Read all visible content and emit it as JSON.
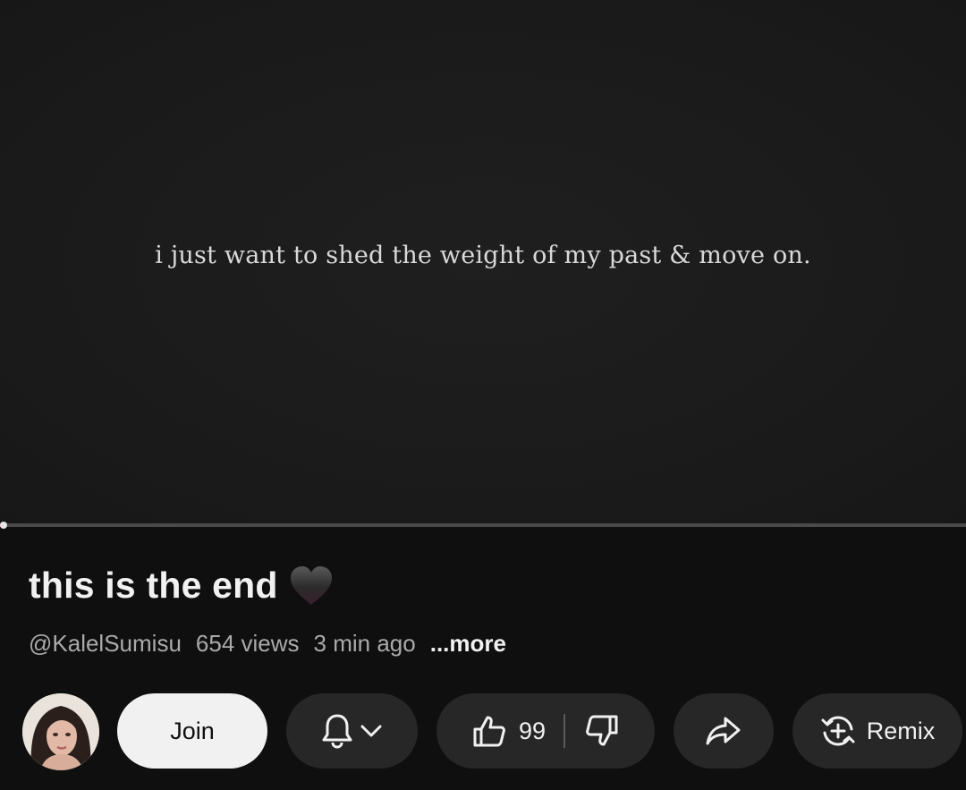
{
  "video": {
    "caption": "i just want to shed the weight of my past & move on."
  },
  "info": {
    "title": "this is the end",
    "channel": "@KalelSumisu",
    "views": "654 views",
    "time_ago": "3 min ago",
    "more_label": "...more"
  },
  "actions": {
    "join_label": "Join",
    "like_count": "99",
    "remix_label": "Remix"
  },
  "colors": {
    "background": "#0f0f0f",
    "pill": "#272727",
    "join": "#f1f1f1"
  },
  "icons": [
    "black-heart-icon",
    "bell-icon",
    "chevron-down-icon",
    "thumbs-up-icon",
    "thumbs-down-icon",
    "share-icon",
    "remix-icon"
  ]
}
